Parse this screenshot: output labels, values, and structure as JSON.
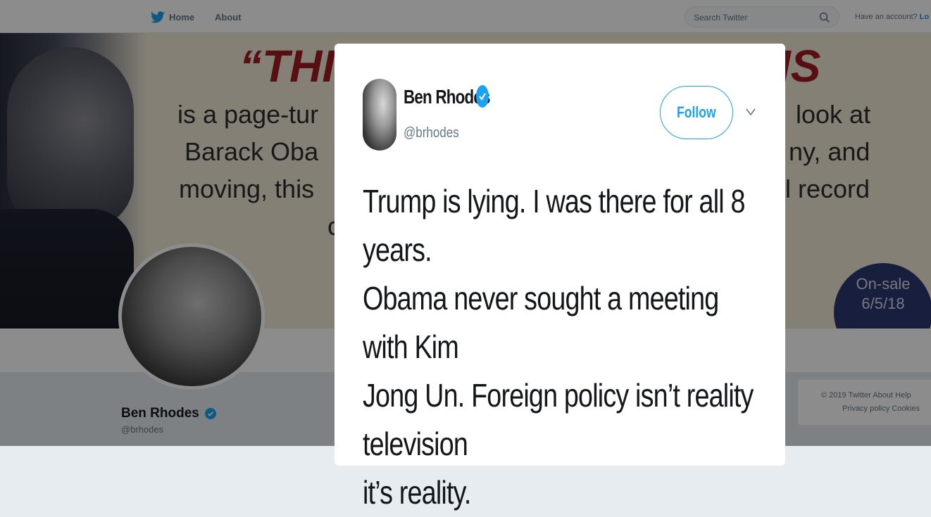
{
  "nav": {
    "home_label": "Home",
    "about_label": "About",
    "search_placeholder": "Search Twitter",
    "account_prompt": "Have an account?",
    "login_label": "Lo"
  },
  "banner": {
    "quote_left": "“THI",
    "quote_right": "IS",
    "lines": [
      {
        "left": "is a page-tur",
        "right": "look at"
      },
      {
        "left": "Barack Oba",
        "right": "ny, and"
      },
      {
        "left": "moving, this",
        "right": "l record"
      },
      {
        "left": "c",
        "right": ""
      }
    ],
    "onsale_line1": "On-sale",
    "onsale_line2": "6/5/18"
  },
  "profile": {
    "name": "Ben Rhodes",
    "handle": "@brhodes"
  },
  "footer": {
    "line1": "© 2019 Twitter   About   Help",
    "line2": "Privacy policy   Cookies"
  },
  "tweet": {
    "author_name": "Ben Rhodes",
    "author_handle": "@brhodes",
    "follow_label": "Follow",
    "text_lines": [
      "Trump is lying. I was there for all 8 years.",
      "Obama never sought a meeting with Kim",
      "Jong Un. Foreign policy isn’t reality television",
      "it’s reality."
    ]
  },
  "colors": {
    "twitter_blue": "#1da1f2",
    "banner_red": "#a01c22",
    "onsale_navy": "#2c3770"
  }
}
